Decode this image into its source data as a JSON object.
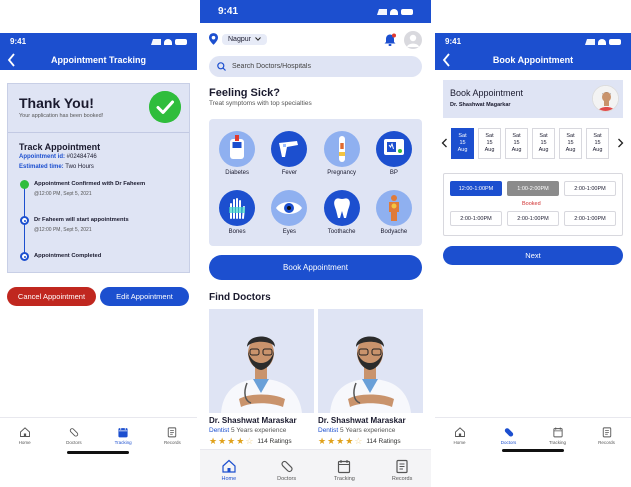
{
  "status": {
    "time": "9:41"
  },
  "tabs": [
    {
      "label": "Home",
      "icon": "home-icon"
    },
    {
      "label": "Doctors",
      "icon": "pill-icon"
    },
    {
      "label": "Tracking",
      "icon": "calendar-icon"
    },
    {
      "label": "Records",
      "icon": "records-icon"
    }
  ],
  "tracking": {
    "title": "Appointment Tracking",
    "thanks": "Thank You!",
    "thanks_sub": "Your application has been booked!",
    "track_title": "Track Appointment",
    "appt_id_label": "Appointment id:",
    "appt_id": "#02484746",
    "est_label": "Estimated time:",
    "est_value": "Two Hours",
    "timeline": [
      {
        "text": "Appointment Confirmed with Dr Faheem",
        "time": "@12:00 PM, Sept 5, 2021",
        "state": "done"
      },
      {
        "text": "Dr Faheem will start appointments",
        "time": "@12:00 PM, Sept 5, 2021",
        "state": "pending"
      },
      {
        "text": "Appointment Completed",
        "time": "",
        "state": "pending"
      }
    ],
    "cancel_label": "Cancel Appointment",
    "edit_label": "Edit Appointment",
    "active_tab": "Tracking"
  },
  "home": {
    "city": "Nagpur",
    "search_placeholder": "Search Doctors/Hospitals",
    "feel_title": "Feeling Sick?",
    "feel_sub": "Treat symptoms with top specialties",
    "symptoms": [
      {
        "label": "Diabetes",
        "icon": "glucometer-icon",
        "color": "#8fb0f0"
      },
      {
        "label": "Fever",
        "icon": "thermometer-icon",
        "color": "#1c4fcf"
      },
      {
        "label": "Pregnancy",
        "icon": "pregnancy-test-icon",
        "color": "#8fb0f0"
      },
      {
        "label": "BP",
        "icon": "bp-monitor-icon",
        "color": "#1c4fcf"
      },
      {
        "label": "Bones",
        "icon": "xray-hand-icon",
        "color": "#1c4fcf"
      },
      {
        "label": "Eyes",
        "icon": "eye-icon",
        "color": "#8fb0f0"
      },
      {
        "label": "Toothache",
        "icon": "tooth-icon",
        "color": "#1c4fcf"
      },
      {
        "label": "Bodyache",
        "icon": "body-icon",
        "color": "#8fb0f0"
      }
    ],
    "book_label": "Book Appointment",
    "find_title": "Find Doctors",
    "doctors": [
      {
        "name": "Dr. Shashwat Maraskar",
        "spec": "Dentist",
        "exp": "5 Years experience",
        "stars": 4,
        "ratings": "114 Ratings"
      },
      {
        "name": "Dr. Shashwat Maraskar",
        "spec": "Dentist",
        "exp": "5 Years experience",
        "stars": 4,
        "ratings": "114 Ratings"
      }
    ],
    "active_tab": "Home"
  },
  "booking": {
    "title": "Book Appointment",
    "card_title": "Book Appointment",
    "doctor": "Dr. Shashwat Magarkar",
    "dates": [
      {
        "day": "Sat",
        "date": "15",
        "month": "Aug",
        "selected": true
      },
      {
        "day": "Sat",
        "date": "15",
        "month": "Aug",
        "selected": false
      },
      {
        "day": "Sat",
        "date": "15",
        "month": "Aug",
        "selected": false
      },
      {
        "day": "Sat",
        "date": "15",
        "month": "Aug",
        "selected": false
      },
      {
        "day": "Sat",
        "date": "15",
        "month": "Aug",
        "selected": false
      },
      {
        "day": "Sat",
        "date": "15",
        "month": "Aug",
        "selected": false
      }
    ],
    "slots": [
      {
        "label": "12:00-1:00PM",
        "state": "selected"
      },
      {
        "label": "1:00-2:00PM",
        "state": "booked"
      },
      {
        "label": "2:00-1:00PM",
        "state": "free"
      },
      {
        "label": "2:00-1:00PM",
        "state": "free"
      },
      {
        "label": "2:00-1:00PM",
        "state": "free"
      },
      {
        "label": "2:00-1:00PM",
        "state": "free"
      }
    ],
    "booked_label": "Booked",
    "next_label": "Next",
    "active_tab": "Doctors"
  },
  "colors": {
    "primary": "#1c4fcf",
    "light": "#dfe4f4",
    "danger": "#c0271f",
    "success": "#2fbd3c",
    "star": "#e0a11a"
  }
}
